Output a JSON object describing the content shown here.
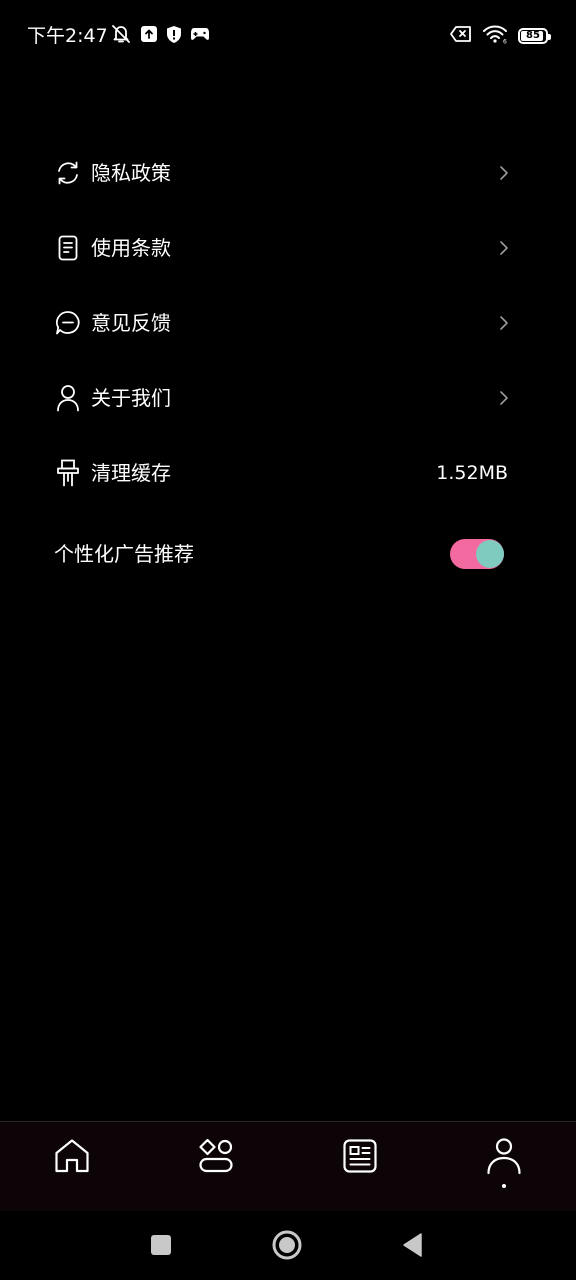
{
  "status_bar": {
    "time": "下午2:47",
    "battery_level": "85",
    "icons_left": [
      "mute-bell-icon",
      "upload-icon",
      "shield-icon",
      "game-controller-icon"
    ],
    "icons_right": [
      "sim-error-icon",
      "wifi-icon",
      "battery-icon"
    ]
  },
  "settings": {
    "items": [
      {
        "label": "隐私政策",
        "icon": "refresh-icon",
        "trailing": "chevron"
      },
      {
        "label": "使用条款",
        "icon": "document-icon",
        "trailing": "chevron"
      },
      {
        "label": "意见反馈",
        "icon": "chat-bubble-icon",
        "trailing": "chevron"
      },
      {
        "label": "关于我们",
        "icon": "person-icon",
        "trailing": "chevron"
      },
      {
        "label": "清理缓存",
        "icon": "brush-icon",
        "trailing": "value",
        "value": "1.52MB"
      }
    ],
    "ad_toggle": {
      "label": "个性化广告推荐",
      "state": "on"
    }
  },
  "bottom_nav": {
    "items": [
      "home-icon",
      "category-icon",
      "news-icon",
      "profile-icon"
    ],
    "active": "profile-icon"
  },
  "system_nav": {
    "buttons": [
      "recents-button",
      "home-button",
      "back-button"
    ]
  },
  "colors": {
    "background": "#000000",
    "text": "#ffffff",
    "toggle_track": "#f36aa0",
    "toggle_knob": "#7fcbbf",
    "nav_background": "#0c0406",
    "chevron": "#9a9a9a"
  }
}
